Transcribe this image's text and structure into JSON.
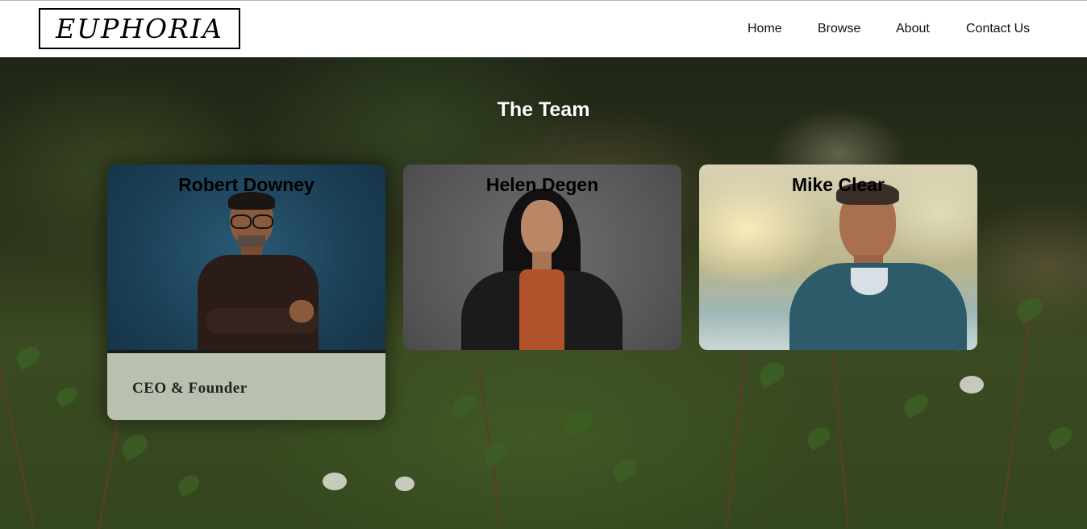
{
  "header": {
    "logo_text": "EUPHORIA",
    "nav": [
      {
        "label": "Home"
      },
      {
        "label": "Browse"
      },
      {
        "label": "About"
      },
      {
        "label": "Contact Us"
      }
    ]
  },
  "main": {
    "title": "The Team",
    "cards": [
      {
        "name": "Robert Downey",
        "role": "CEO & Founder",
        "expanded": true
      },
      {
        "name": "Helen Degen"
      },
      {
        "name": "Mike Clear"
      }
    ]
  },
  "colors": {
    "header_bg": "#ffffff",
    "card1_bg": "#1f4a63",
    "card2_bg": "#5e5e5e",
    "card3_bg": "#d8d6c0",
    "title_color": "#ffffff"
  }
}
